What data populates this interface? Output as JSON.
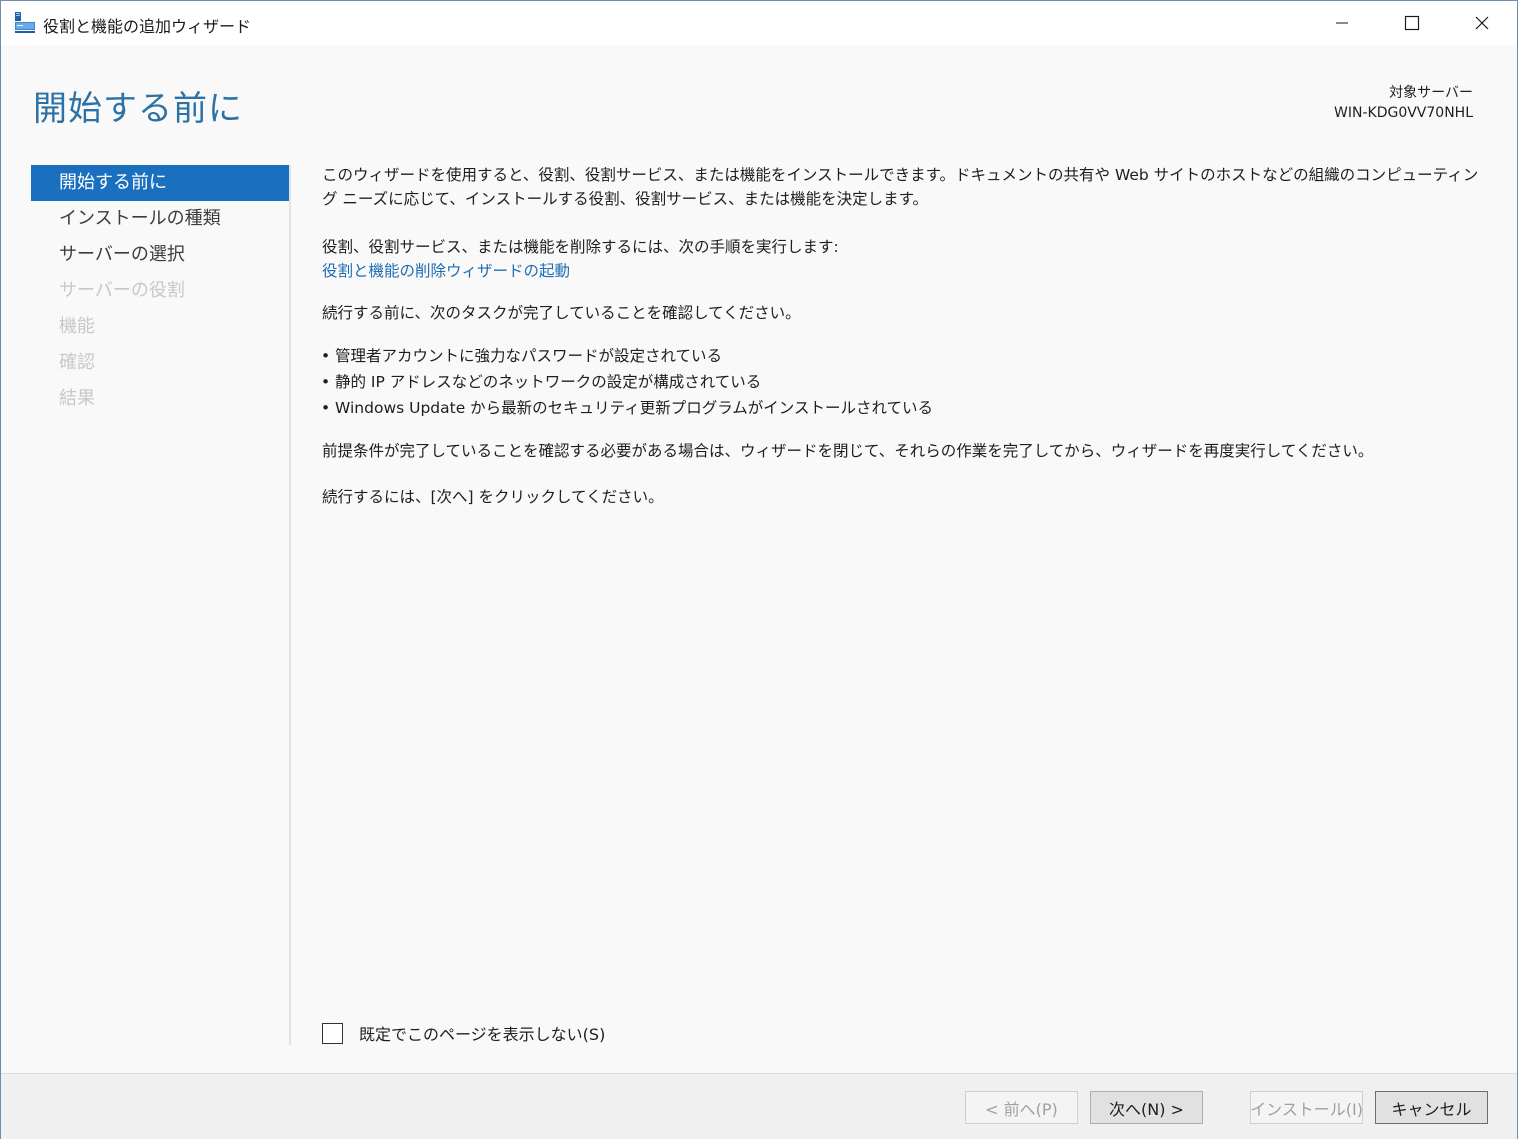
{
  "window": {
    "title": "役割と機能の追加ウィザード",
    "icons": {
      "app": "server-manager-icon",
      "minimize": "minimize-icon",
      "maximize": "maximize-icon",
      "close": "close-icon"
    }
  },
  "header": {
    "page_title": "開始する前に",
    "target_server_label": "対象サーバー",
    "target_server_name": "WIN-KDG0VV70NHL"
  },
  "nav": {
    "items": [
      {
        "label": "開始する前に",
        "state": "active"
      },
      {
        "label": "インストールの種類",
        "state": "enabled"
      },
      {
        "label": "サーバーの選択",
        "state": "enabled"
      },
      {
        "label": "サーバーの役割",
        "state": "disabled"
      },
      {
        "label": "機能",
        "state": "disabled"
      },
      {
        "label": "確認",
        "state": "disabled"
      },
      {
        "label": "結果",
        "state": "disabled"
      }
    ]
  },
  "main": {
    "intro": "このウィザードを使用すると、役割、役割サービス、または機能をインストールできます。ドキュメントの共有や Web サイトのホストなどの組織のコンピューティング ニーズに応じて、インストールする役割、役割サービス、または機能を決定します。",
    "remove_instruction": "役割、役割サービス、または機能を削除するには、次の手順を実行します:",
    "remove_link": "役割と機能の削除ウィザードの起動",
    "before_continue": "続行する前に、次のタスクが完了していることを確認してください。",
    "checklist": [
      "管理者アカウントに強力なパスワードが設定されている",
      "静的 IP アドレスなどのネットワークの設定が構成されている",
      "Windows Update から最新のセキュリティ更新プログラムがインストールされている"
    ],
    "prerequisite_note": "前提条件が完了していることを確認する必要がある場合は、ウィザードを閉じて、それらの作業を完了してから、ウィザードを再度実行してください。",
    "continue_note": "続行するには、[次へ] をクリックしてください。"
  },
  "skip_page_checkbox": {
    "label": "既定でこのページを表示しない(S)",
    "checked": false
  },
  "footer": {
    "prev_label": "< 前へ(P)",
    "next_label": "次へ(N) >",
    "install_label": "インストール(I)",
    "cancel_label": "キャンセル"
  },
  "colors": {
    "accent": "#1a6fbf",
    "heading": "#2d72a6",
    "link": "#1e6cb4",
    "disabled": "#c8c8c8"
  }
}
